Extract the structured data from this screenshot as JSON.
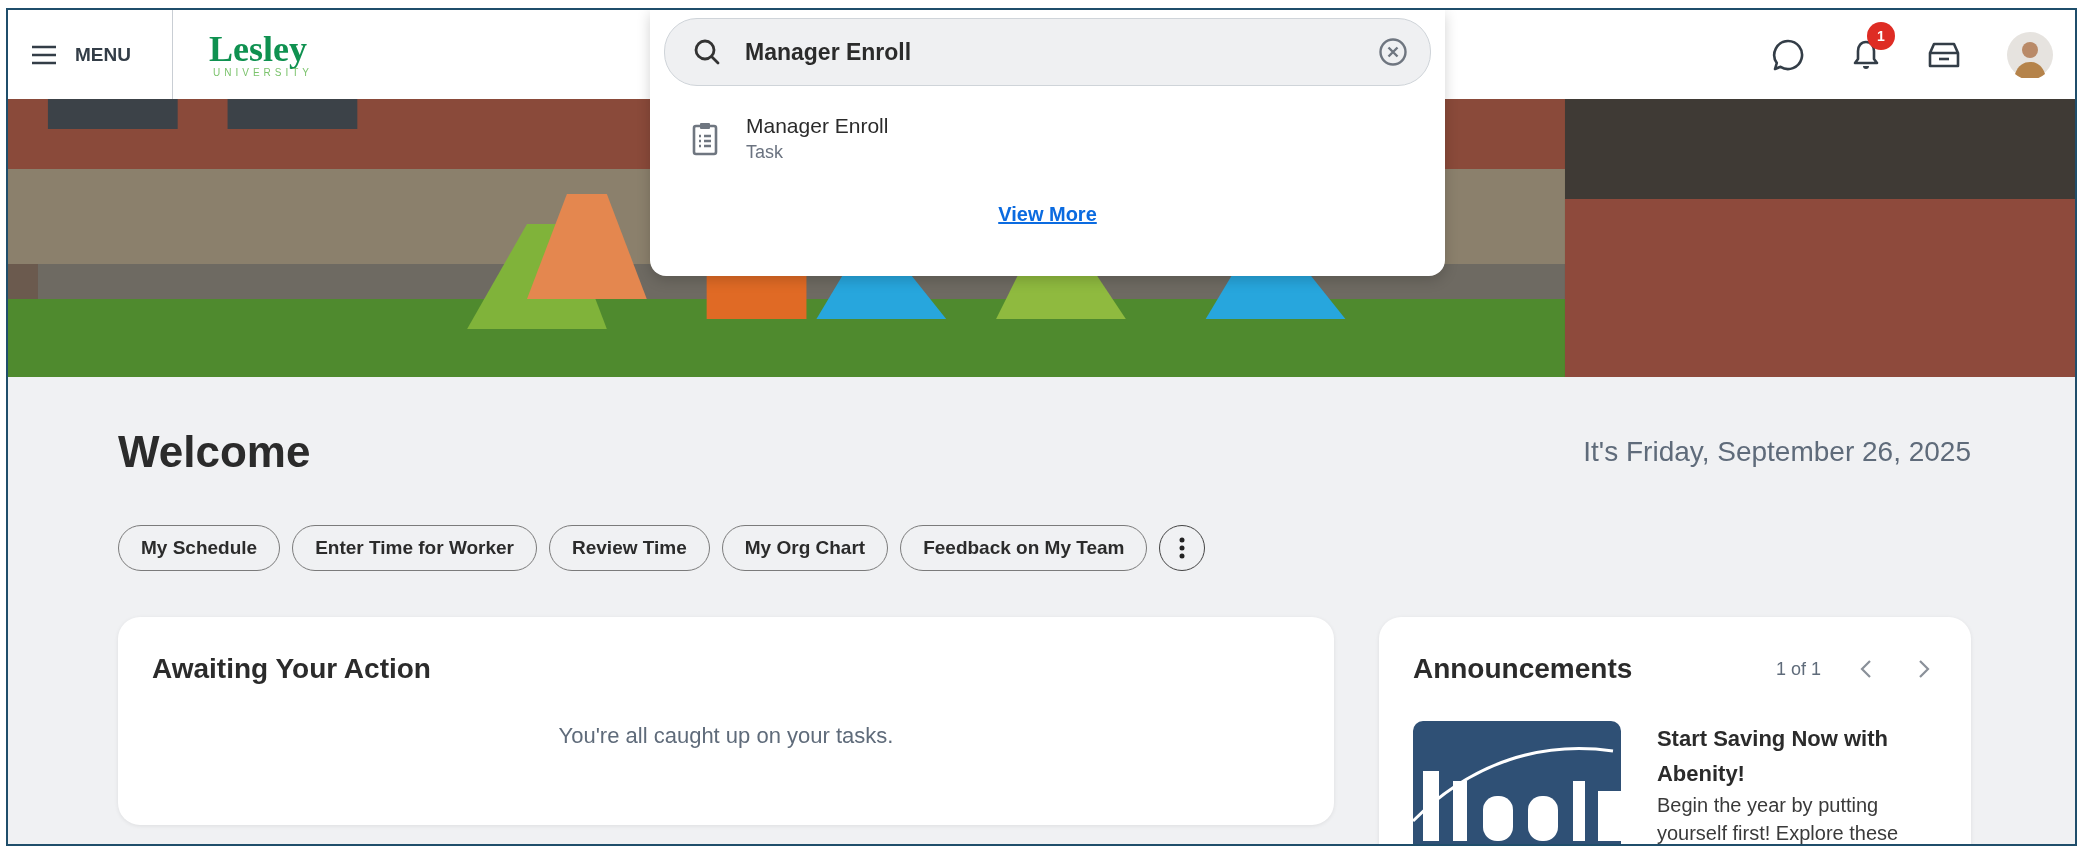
{
  "header": {
    "menu_label": "MENU",
    "logo": {
      "name": "Lesley",
      "subtitle": "UNIVERSITY"
    },
    "notifications": {
      "count": "1"
    }
  },
  "search": {
    "value": "Manager Enroll",
    "results": [
      {
        "title": "Manager Enroll",
        "type": "Task"
      }
    ],
    "view_more": "View More"
  },
  "welcome": {
    "title": "Welcome",
    "date": "It's Friday, September 26, 2025"
  },
  "shortcuts": [
    "My Schedule",
    "Enter Time for Worker",
    "Review Time",
    "My Org Chart",
    "Feedback on My Team"
  ],
  "awaiting_action": {
    "title": "Awaiting Your Action",
    "message": "You're all caught up on your tasks."
  },
  "announcements": {
    "title": "Announcements",
    "pager": "1 of 1",
    "items": [
      {
        "kind": "picture",
        "title": "Start Saving Now with Abenity!",
        "body": "Begin the year by putting yourself first! Explore these"
      }
    ]
  }
}
